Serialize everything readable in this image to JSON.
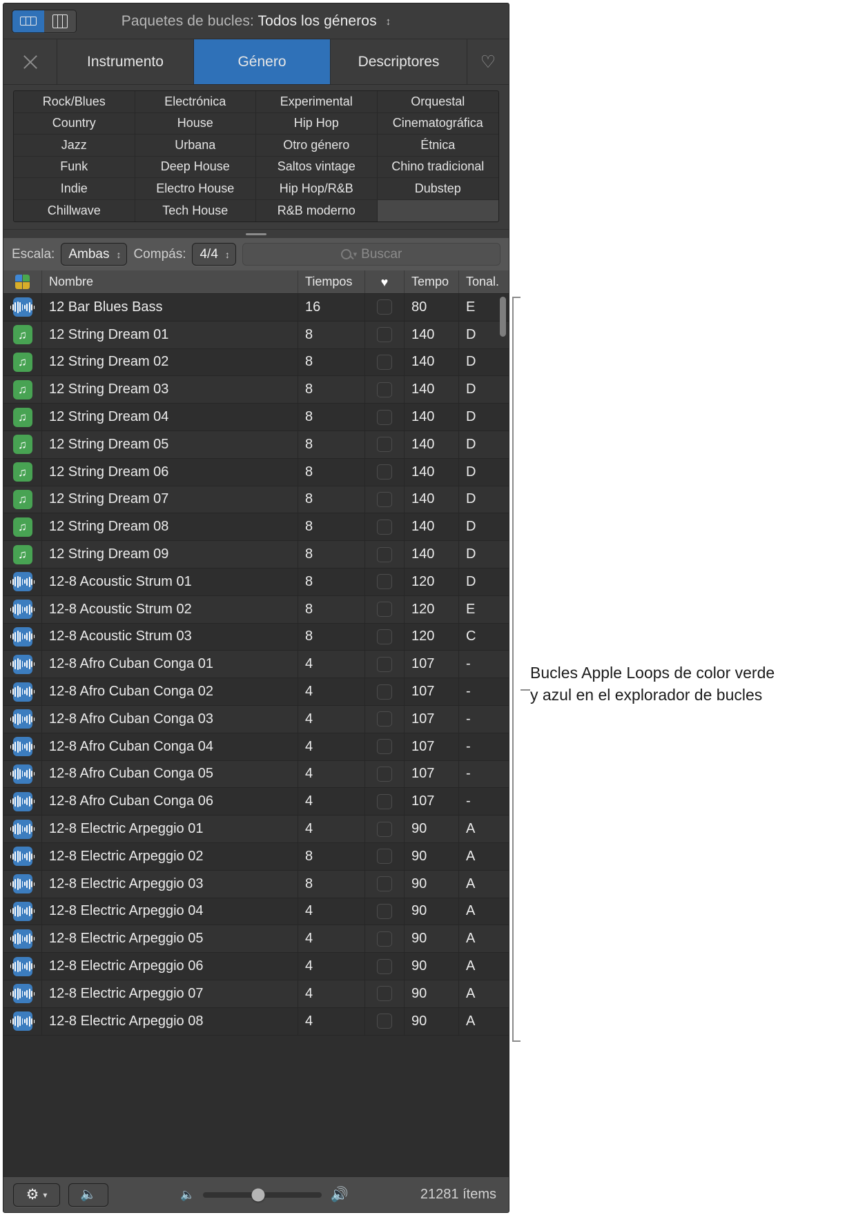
{
  "titlebar": {
    "view_toggle": [
      {
        "name": "button-view-packs",
        "icon": "grid-rows-icon",
        "active": true
      },
      {
        "name": "button-view-columns",
        "icon": "columns-icon",
        "active": false
      }
    ],
    "label": "Paquetes de bucles:",
    "value": "Todos los géneros",
    "stepper": "⌃⌄"
  },
  "tabs": {
    "close_icon": "close-icon",
    "items": [
      {
        "label": "Instrumento",
        "selected": false
      },
      {
        "label": "Género",
        "selected": true
      },
      {
        "label": "Descriptores",
        "selected": false
      }
    ],
    "favorites_icon": "heart-outline-icon"
  },
  "genres": {
    "rows": [
      [
        "Rock/Blues",
        "Electrónica",
        "Experimental",
        "Orquestal"
      ],
      [
        "Country",
        "House",
        "Hip Hop",
        "Cinematográfica"
      ],
      [
        "Jazz",
        "Urbana",
        "Otro género",
        "Étnica"
      ],
      [
        "Funk",
        "Deep House",
        "Saltos vintage",
        "Chino tradicional"
      ],
      [
        "Indie",
        "Electro House",
        "Hip Hop/R&B",
        "Dubstep"
      ],
      [
        "Chillwave",
        "Tech House",
        "R&B moderno",
        ""
      ]
    ]
  },
  "filterbar": {
    "scale_label": "Escala:",
    "scale_value": "Ambas",
    "meter_label": "Compás:",
    "meter_value": "4/4",
    "search_placeholder": "Buscar",
    "search_icon": "search-icon",
    "search_value": ""
  },
  "table": {
    "columns": {
      "icon": "",
      "name": "Nombre",
      "beats": "Tiempos",
      "fav": "♥",
      "tempo": "Tempo",
      "key": "Tonal."
    },
    "header_icon": "four-color-squares-icon",
    "rows": [
      {
        "icon": "audio",
        "name": "12 Bar Blues Bass",
        "beats": "16",
        "fav": false,
        "tempo": "80",
        "key": "E"
      },
      {
        "icon": "midi",
        "name": "12 String Dream 01",
        "beats": "8",
        "fav": false,
        "tempo": "140",
        "key": "D"
      },
      {
        "icon": "midi",
        "name": "12 String Dream 02",
        "beats": "8",
        "fav": false,
        "tempo": "140",
        "key": "D"
      },
      {
        "icon": "midi",
        "name": "12 String Dream 03",
        "beats": "8",
        "fav": false,
        "tempo": "140",
        "key": "D"
      },
      {
        "icon": "midi",
        "name": "12 String Dream 04",
        "beats": "8",
        "fav": false,
        "tempo": "140",
        "key": "D"
      },
      {
        "icon": "midi",
        "name": "12 String Dream 05",
        "beats": "8",
        "fav": false,
        "tempo": "140",
        "key": "D"
      },
      {
        "icon": "midi",
        "name": "12 String Dream 06",
        "beats": "8",
        "fav": false,
        "tempo": "140",
        "key": "D"
      },
      {
        "icon": "midi",
        "name": "12 String Dream 07",
        "beats": "8",
        "fav": false,
        "tempo": "140",
        "key": "D"
      },
      {
        "icon": "midi",
        "name": "12 String Dream 08",
        "beats": "8",
        "fav": false,
        "tempo": "140",
        "key": "D"
      },
      {
        "icon": "midi",
        "name": "12 String Dream 09",
        "beats": "8",
        "fav": false,
        "tempo": "140",
        "key": "D"
      },
      {
        "icon": "audio",
        "name": "12-8 Acoustic Strum 01",
        "beats": "8",
        "fav": false,
        "tempo": "120",
        "key": "D"
      },
      {
        "icon": "audio",
        "name": "12-8 Acoustic Strum 02",
        "beats": "8",
        "fav": false,
        "tempo": "120",
        "key": "E"
      },
      {
        "icon": "audio",
        "name": "12-8 Acoustic Strum 03",
        "beats": "8",
        "fav": false,
        "tempo": "120",
        "key": "C"
      },
      {
        "icon": "audio",
        "name": "12-8 Afro Cuban Conga 01",
        "beats": "4",
        "fav": false,
        "tempo": "107",
        "key": "-"
      },
      {
        "icon": "audio",
        "name": "12-8 Afro Cuban Conga 02",
        "beats": "4",
        "fav": false,
        "tempo": "107",
        "key": "-"
      },
      {
        "icon": "audio",
        "name": "12-8 Afro Cuban Conga 03",
        "beats": "4",
        "fav": false,
        "tempo": "107",
        "key": "-"
      },
      {
        "icon": "audio",
        "name": "12-8 Afro Cuban Conga 04",
        "beats": "4",
        "fav": false,
        "tempo": "107",
        "key": "-"
      },
      {
        "icon": "audio",
        "name": "12-8 Afro Cuban Conga 05",
        "beats": "4",
        "fav": false,
        "tempo": "107",
        "key": "-"
      },
      {
        "icon": "audio",
        "name": "12-8 Afro Cuban Conga 06",
        "beats": "4",
        "fav": false,
        "tempo": "107",
        "key": "-"
      },
      {
        "icon": "audio",
        "name": "12-8 Electric Arpeggio 01",
        "beats": "4",
        "fav": false,
        "tempo": "90",
        "key": "A"
      },
      {
        "icon": "audio",
        "name": "12-8 Electric Arpeggio 02",
        "beats": "8",
        "fav": false,
        "tempo": "90",
        "key": "A"
      },
      {
        "icon": "audio",
        "name": "12-8 Electric Arpeggio 03",
        "beats": "8",
        "fav": false,
        "tempo": "90",
        "key": "A"
      },
      {
        "icon": "audio",
        "name": "12-8 Electric Arpeggio 04",
        "beats": "4",
        "fav": false,
        "tempo": "90",
        "key": "A"
      },
      {
        "icon": "audio",
        "name": "12-8 Electric Arpeggio 05",
        "beats": "4",
        "fav": false,
        "tempo": "90",
        "key": "A"
      },
      {
        "icon": "audio",
        "name": "12-8 Electric Arpeggio 06",
        "beats": "4",
        "fav": false,
        "tempo": "90",
        "key": "A"
      },
      {
        "icon": "audio",
        "name": "12-8 Electric Arpeggio 07",
        "beats": "4",
        "fav": false,
        "tempo": "90",
        "key": "A"
      },
      {
        "icon": "audio",
        "name": "12-8 Electric Arpeggio 08",
        "beats": "4",
        "fav": false,
        "tempo": "90",
        "key": "A"
      }
    ]
  },
  "bottombar": {
    "gear_icon": "gear-icon",
    "gear_chevron": "⌄",
    "speaker_icon": "speaker-mute-icon",
    "volume_low_icon": "speaker-low-icon",
    "volume_high_icon": "speaker-high-icon",
    "volume_percent": 46,
    "item_count": "21281 ítems"
  },
  "callout": {
    "text": "Bucles Apple Loops de color verde y azul en el explorador de bucles"
  },
  "colors": {
    "accent_blue": "#2f71b8",
    "audio_icon": "#3c7dbf",
    "midi_icon": "#48a353",
    "window_bg": "#3a3a3a",
    "page_bg": "#ffffff"
  }
}
